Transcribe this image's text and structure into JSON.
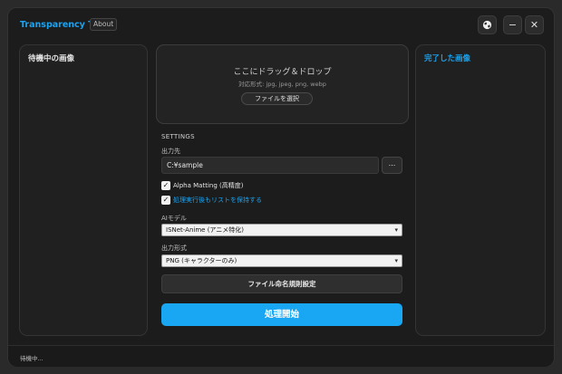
{
  "app": {
    "title": "Transparency Tool",
    "about_label": "About",
    "theme_icon": "globe-icon",
    "minimize_glyph": "−",
    "close_glyph": "✕"
  },
  "panels": {
    "queue_title": "待機中の画像",
    "done_title": "完了した画像"
  },
  "dropzone": {
    "main_text": "ここにドラッグ＆ドロップ",
    "formats_text": "対応形式: jpg, jpeg, png, webp",
    "select_button": "ファイルを選択"
  },
  "settings": {
    "header": "SETTINGS",
    "output_label": "出力先",
    "output_value": "C:¥sample",
    "browse_label": "...",
    "alpha_matting_label": "Alpha Matting (高精度)",
    "alpha_matting_checked": true,
    "keep_list_label": "処理実行後もリストを保持する",
    "keep_list_checked": true,
    "ai_model_label": "AIモデル",
    "ai_model_value": "ISNet-Anime (アニメ特化)",
    "output_format_label": "出力形式",
    "output_format_value": "PNG (キャラクターのみ)",
    "naming_button": "ファイル命名規則設定",
    "start_button": "処理開始"
  },
  "status": {
    "text": "待機中..."
  },
  "colors": {
    "accent": "#19a7f3",
    "background": "#1c1c1c",
    "panel": "#202020"
  }
}
